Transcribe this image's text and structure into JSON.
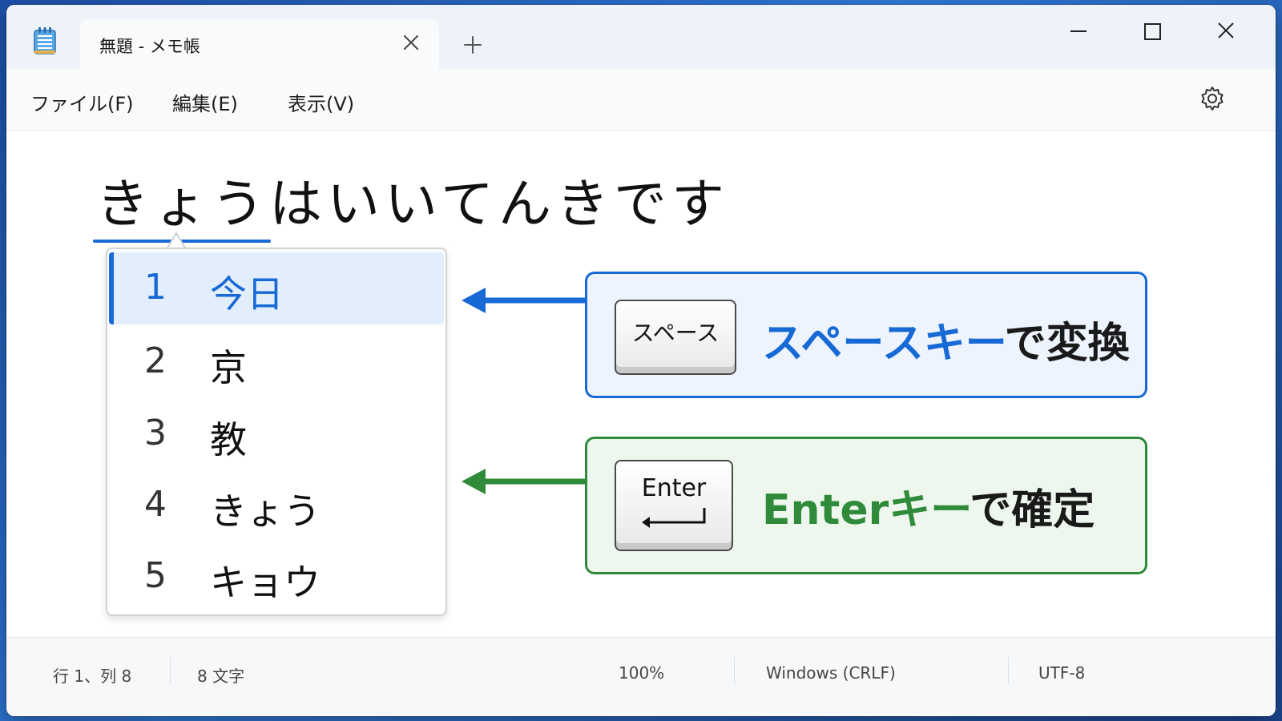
{
  "window": {
    "tab_title": "無題 - メモ帳",
    "icons": {
      "app": "notepad-icon",
      "tab_close": "close-icon",
      "new_tab": "plus-icon",
      "minimize": "minimize-icon",
      "maximize": "maximize-icon",
      "close": "close-icon"
    }
  },
  "menu": {
    "file": "ファイル(F)",
    "edit": "編集(E)",
    "view": "表示(V)",
    "settings_icon": "gear-icon"
  },
  "editor": {
    "composition": "きょう",
    "rest": "はいいてんきです"
  },
  "candidates": [
    {
      "num": "1",
      "text": "今日",
      "selected": true
    },
    {
      "num": "2",
      "text": "京",
      "selected": false
    },
    {
      "num": "3",
      "text": "教",
      "selected": false
    },
    {
      "num": "4",
      "text": "きょう",
      "selected": false
    },
    {
      "num": "5",
      "text": "キョウ",
      "selected": false
    }
  ],
  "callouts": {
    "space": {
      "key_label": "スペース",
      "highlight": "スペースキー",
      "suffix": "で変換",
      "color": "#1769d6"
    },
    "enter": {
      "key_label": "Enter",
      "highlight": "Enterキー",
      "suffix": "で確定",
      "color": "#2f8b3a"
    }
  },
  "status": {
    "position": "行 1、列 8",
    "char_count": "8 文字",
    "zoom": "100%",
    "line_ending": "Windows (CRLF)",
    "encoding": "UTF-8"
  }
}
